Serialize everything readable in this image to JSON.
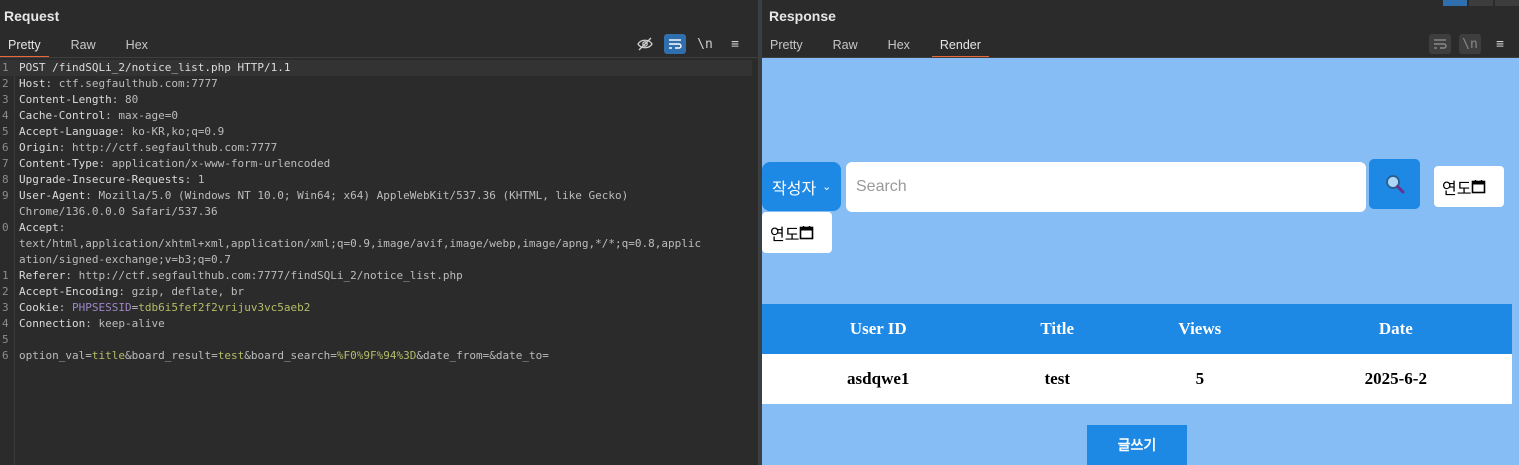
{
  "request": {
    "title": "Request",
    "tabs": [
      "Pretty",
      "Raw",
      "Hex"
    ],
    "active_tab": "Pretty",
    "toolbar": {
      "wrap": "\\n",
      "menu": "≡"
    },
    "lines": [
      {
        "n": "1",
        "parts": [
          [
            "k",
            "POST /findSQLi_2/notice_list.php HTTP/1.1"
          ]
        ]
      },
      {
        "n": "2",
        "parts": [
          [
            "k",
            "Host"
          ],
          [
            "v",
            ": ctf.segfaulthub.com:7777"
          ]
        ]
      },
      {
        "n": "3",
        "parts": [
          [
            "k",
            "Content-Length"
          ],
          [
            "v",
            ": 80"
          ]
        ]
      },
      {
        "n": "4",
        "parts": [
          [
            "k",
            "Cache-Control"
          ],
          [
            "v",
            ": max-age=0"
          ]
        ]
      },
      {
        "n": "5",
        "parts": [
          [
            "k",
            "Accept-Language"
          ],
          [
            "v",
            ": ko-KR,ko;q=0.9"
          ]
        ]
      },
      {
        "n": "6",
        "parts": [
          [
            "k",
            "Origin"
          ],
          [
            "v",
            ": http://ctf.segfaulthub.com:7777"
          ]
        ]
      },
      {
        "n": "7",
        "parts": [
          [
            "k",
            "Content-Type"
          ],
          [
            "v",
            ": application/x-www-form-urlencoded"
          ]
        ]
      },
      {
        "n": "8",
        "parts": [
          [
            "k",
            "Upgrade-Insecure-Requests"
          ],
          [
            "v",
            ": 1"
          ]
        ]
      },
      {
        "n": "9",
        "parts": [
          [
            "k",
            "User-Agent"
          ],
          [
            "v",
            ": Mozilla/5.0 (Windows NT 10.0; Win64; x64) AppleWebKit/537.36 (KHTML, like Gecko)"
          ]
        ]
      },
      {
        "n": "",
        "parts": [
          [
            "v",
            "Chrome/136.0.0.0 Safari/537.36"
          ]
        ]
      },
      {
        "n": "0",
        "parts": [
          [
            "k",
            "Accept"
          ],
          [
            "v",
            ":"
          ]
        ]
      },
      {
        "n": "",
        "parts": [
          [
            "v",
            "text/html,application/xhtml+xml,application/xml;q=0.9,image/avif,image/webp,image/apng,*/*;q=0.8,applic"
          ]
        ]
      },
      {
        "n": "",
        "parts": [
          [
            "v",
            "ation/signed-exchange;v=b3;q=0.7"
          ]
        ]
      },
      {
        "n": "1",
        "parts": [
          [
            "k",
            "Referer"
          ],
          [
            "v",
            ": http://ctf.segfaulthub.com:7777/findSQLi_2/notice_list.php"
          ]
        ]
      },
      {
        "n": "2",
        "parts": [
          [
            "k",
            "Accept-Encoding"
          ],
          [
            "v",
            ": gzip, deflate, br"
          ]
        ]
      },
      {
        "n": "3",
        "parts": [
          [
            "k",
            "Cookie"
          ],
          [
            "v",
            ": "
          ],
          [
            "cy",
            "PHPSESSID"
          ],
          [
            "v",
            "="
          ],
          [
            "cg",
            "tdb6i5fef2f2vrijuv3vc5aeb2"
          ]
        ]
      },
      {
        "n": "4",
        "parts": [
          [
            "k",
            "Connection"
          ],
          [
            "v",
            ": keep-alive"
          ]
        ]
      },
      {
        "n": "5",
        "parts": []
      },
      {
        "n": "6",
        "parts": [
          [
            "v",
            "option_val="
          ],
          [
            "cg",
            "title"
          ],
          [
            "v",
            "&board_result="
          ],
          [
            "cg",
            "test"
          ],
          [
            "v",
            "&board_search="
          ],
          [
            "cg",
            "%F0%9F%94%3D"
          ],
          [
            "v",
            "&date_from=&date_to="
          ]
        ]
      }
    ]
  },
  "response": {
    "title": "Response",
    "tabs": [
      "Pretty",
      "Raw",
      "Hex",
      "Render"
    ],
    "active_tab": "Render",
    "toolbar": {
      "wrap": "\\n",
      "menu": "≡"
    },
    "render": {
      "select_label": "작성자",
      "search_placeholder": "Search",
      "date_from_label": "연도",
      "date_to_label": "연도",
      "table": {
        "headers": [
          "User ID",
          "Title",
          "Views",
          "Date"
        ],
        "rows": [
          [
            "asdqwe1",
            "test",
            "5",
            "2025-6-2"
          ]
        ]
      },
      "write_button": "글쓰기"
    }
  },
  "colors": {
    "accent_tab": "#e8683b",
    "render_bg": "#85bdf4",
    "primary_blue": "#1e88e5"
  }
}
